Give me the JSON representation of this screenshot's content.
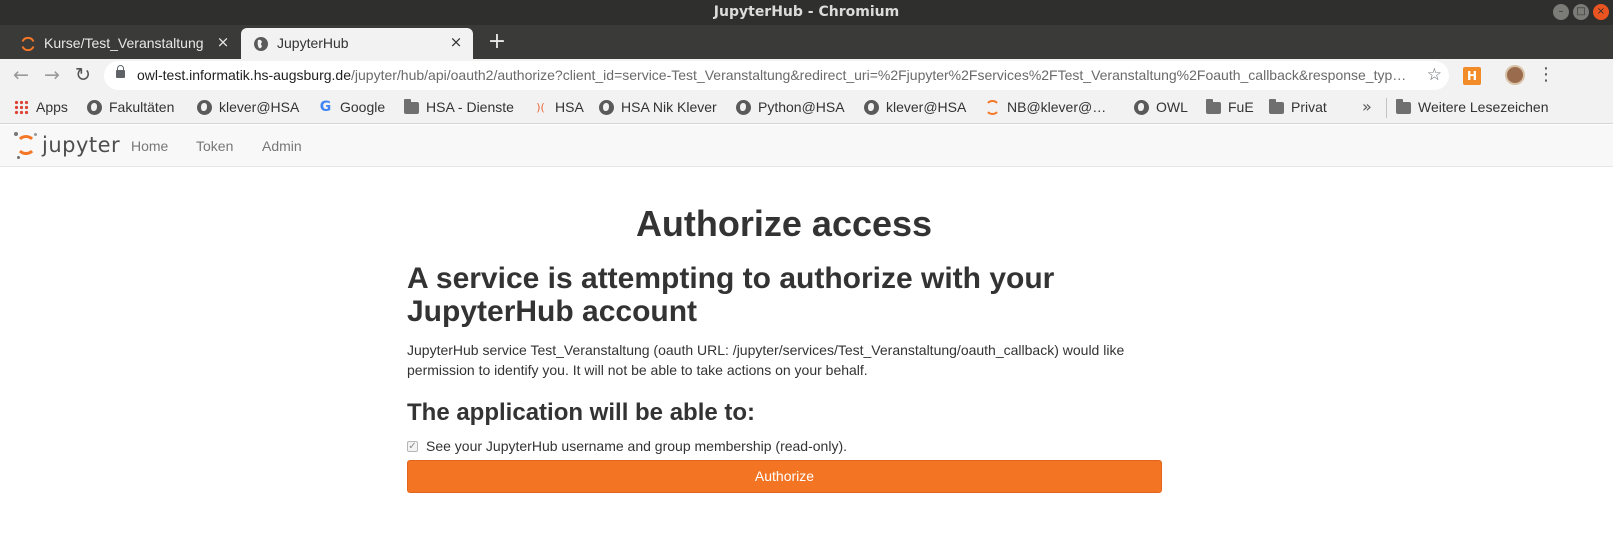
{
  "window": {
    "title": "JupyterHub - Chromium",
    "controls": {
      "minimize": "–",
      "maximize": "□",
      "close": "×"
    }
  },
  "tabs": [
    {
      "label": "Kurse/Test_Veranstaltung",
      "icon": "jupyter-icon",
      "active": false,
      "close": "×"
    },
    {
      "label": "JupyterHub",
      "icon": "globe-icon",
      "active": true,
      "close": "×"
    }
  ],
  "new_tab": "+",
  "toolbar": {
    "back": "←",
    "forward": "→",
    "reload": "↻",
    "url_host": "owl-test.informatik.hs-augsburg.de",
    "url_path": "/jupyter/hub/api/oauth2/authorize?client_id=service-Test_Veranstaltung&redirect_uri=%2Fjupyter%2Fservices%2FTest_Veranstaltung%2Foauth_callback&response_typ…",
    "star": "☆",
    "extension": "H",
    "menu": "⋮"
  },
  "bookmarks": {
    "items": [
      {
        "label": "Apps",
        "icon": "apps-grid-icon"
      },
      {
        "label": "Fakultäten",
        "icon": "globe-icon"
      },
      {
        "label": "klever@HSA",
        "icon": "globe-icon"
      },
      {
        "label": "Google",
        "icon": "google-icon"
      },
      {
        "label": "HSA - Dienste",
        "icon": "folder-icon"
      },
      {
        "label": "HSA",
        "icon": "hsa-icon"
      },
      {
        "label": "HSA Nik Klever",
        "icon": "globe-icon"
      },
      {
        "label": "Python@HSA",
        "icon": "globe-icon"
      },
      {
        "label": "klever@HSA",
        "icon": "globe-icon"
      },
      {
        "label": "NB@klever@…",
        "icon": "jupyter-icon"
      },
      {
        "label": "OWL",
        "icon": "globe-icon"
      },
      {
        "label": "FuE",
        "icon": "folder-icon"
      },
      {
        "label": "Privat",
        "icon": "folder-icon"
      }
    ],
    "overflow": "»",
    "other": "Weitere Lesezeichen"
  },
  "jupyter_nav": {
    "brand": "jupyter",
    "links": [
      "Home",
      "Token",
      "Admin"
    ]
  },
  "page": {
    "title": "Authorize access",
    "heading": "A service is attempting to authorize with your JupyterHub account",
    "description": "JupyterHub service Test_Veranstaltung (oauth URL: /jupyter/services/Test_Veranstaltung/oauth_callback) would like permission to identify you. It will not be able to take actions on your behalf.",
    "scopes_heading": "The application will be able to:",
    "scope_checkbox": "✓",
    "scope": "See your JupyterHub username and group membership (read-only).",
    "authorize_button": "Authorize"
  },
  "colors": {
    "accent": "#f37524",
    "titlebar": "#2f2f2d",
    "close_button": "#e95420"
  }
}
